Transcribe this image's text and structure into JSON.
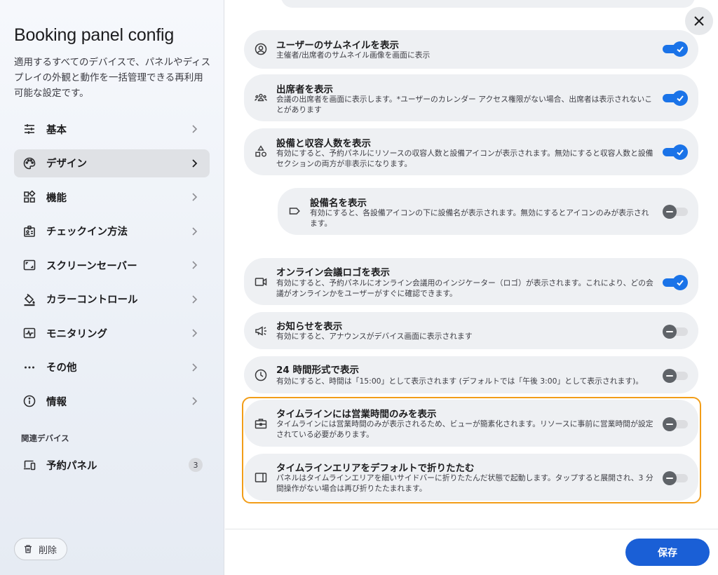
{
  "sidebar": {
    "title": "Booking panel config",
    "description": "適用するすべてのデバイスで、パネルやディスプレイの外観と動作を一括管理できる再利用可能な設定です。",
    "nav": [
      {
        "label": "基本",
        "icon": "sliders-icon"
      },
      {
        "label": "デザイン",
        "icon": "palette-icon",
        "active": true
      },
      {
        "label": "機能",
        "icon": "widgets-icon"
      },
      {
        "label": "チェックイン方法",
        "icon": "badge-icon"
      },
      {
        "label": "スクリーンセーバー",
        "icon": "screensaver-icon"
      },
      {
        "label": "カラーコントロール",
        "icon": "paint-bucket-icon"
      },
      {
        "label": "モニタリング",
        "icon": "monitoring-icon"
      },
      {
        "label": "その他",
        "icon": "more-horizontal-icon"
      },
      {
        "label": "情報",
        "icon": "info-icon"
      }
    ],
    "related_label": "関連デバイス",
    "related_device": {
      "label": "予約パネル",
      "count": "3"
    },
    "delete_label": "削除"
  },
  "settings": [
    {
      "title": "ユーザーのサムネイルを表示",
      "desc": "主催者/出席者のサムネイル画像を画面に表示",
      "enabled": true,
      "icon": "account-circle-icon"
    },
    {
      "title": "出席者を表示",
      "desc": "会議の出席者を画面に表示します。*ユーザーのカレンダー アクセス権限がない場合、出席者は表示されないことがあります",
      "enabled": true,
      "icon": "groups-icon"
    },
    {
      "title": "設備と収容人数を表示",
      "desc": "有効にすると、予約パネルにリソースの収容人数と設備アイコンが表示されます。無効にすると収容人数と設備セクションの両方が非表示になります。",
      "enabled": true,
      "icon": "category-icon"
    },
    {
      "title": "設備名を表示",
      "desc": "有効にすると、各設備アイコンの下に設備名が表示されます。無効にするとアイコンのみが表示されます。",
      "enabled": false,
      "icon": "label-icon"
    },
    {
      "title": "オンライン会議ロゴを表示",
      "desc": "有効にすると、予約パネルにオンライン会議用のインジケーター（ロゴ）が表示されます。これにより、どの会議がオンラインかをユーザーがすぐに確認できます。",
      "enabled": true,
      "icon": "videocam-icon"
    },
    {
      "title": "お知らせを表示",
      "desc": "有効にすると、アナウンスがデバイス画面に表示されます",
      "enabled": false,
      "icon": "campaign-icon"
    },
    {
      "title": "24 時間形式で表示",
      "desc": "有効にすると、時間は「15:00」として表示されます (デフォルトでは「午後 3:00」として表示されます)。",
      "enabled": false,
      "icon": "clock-icon"
    },
    {
      "title": "タイムラインには営業時間のみを表示",
      "desc": "タイムラインには営業時間のみが表示されるため、ビューが簡素化されます。リソースに事前に営業時間が設定されている必要があります。",
      "enabled": false,
      "icon": "business-center-icon"
    },
    {
      "title": "タイムラインエリアをデフォルトで折りたたむ",
      "desc": "パネルはタイムラインエリアを細いサイドバーに折りたたんだ状態で起動します。タップすると展開され、3 分間操作がない場合は再び折りたたまれます。",
      "enabled": false,
      "icon": "side-panel-icon"
    }
  ],
  "save_label": "保存",
  "colors": {
    "accent": "#1a73e8",
    "highlight": "#f29d18",
    "card": "#eef0f3"
  }
}
